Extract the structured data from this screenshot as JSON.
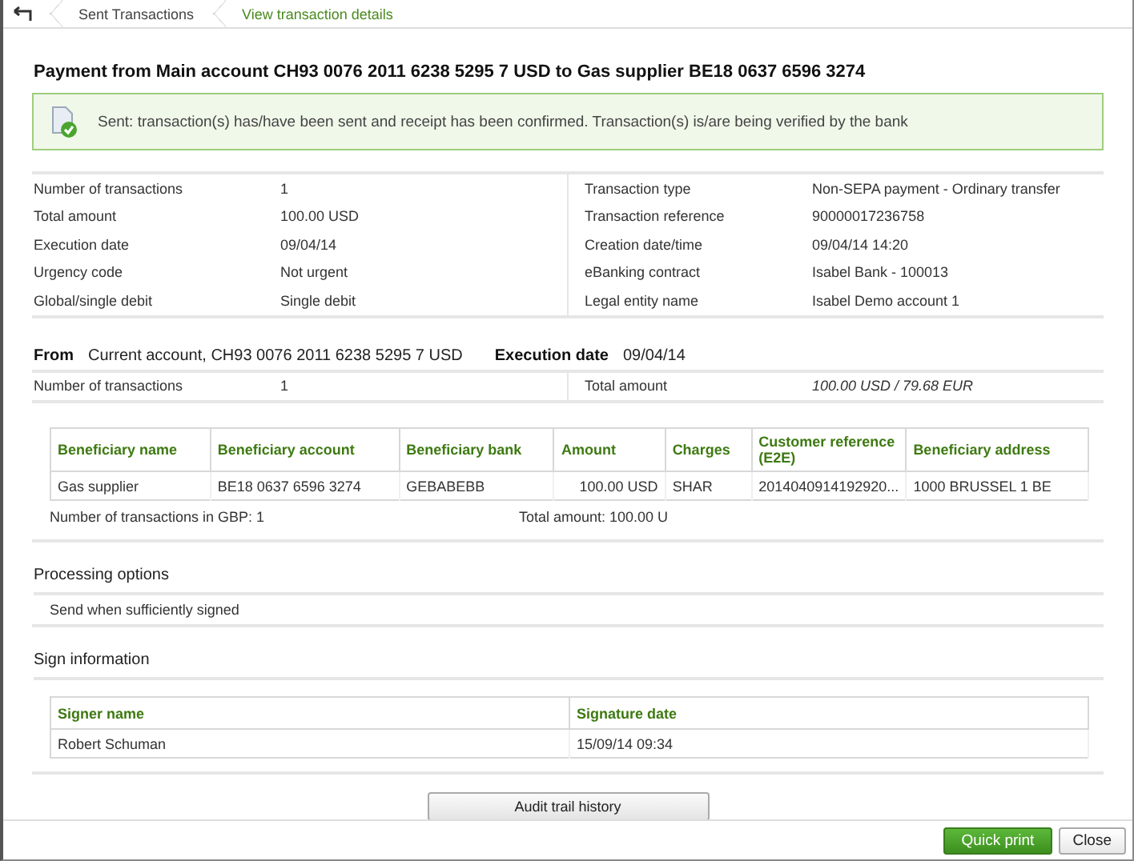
{
  "breadcrumb": [
    {
      "label": "Sent Transactions",
      "selected": false
    },
    {
      "label": "View transaction details",
      "selected": true
    }
  ],
  "title": "Payment from Main account CH93 0076 2011 6238 5295 7 USD to Gas supplier BE18 0637 6596 3274",
  "status_message": "Sent: transaction(s) has/have been sent and receipt has been confirmed. Transaction(s) is/are being verified by the bank",
  "details_left": [
    {
      "label": "Number of transactions",
      "value": "1"
    },
    {
      "label": "Total amount",
      "value": "100.00 USD"
    },
    {
      "label": "Execution date",
      "value": "09/04/14"
    },
    {
      "label": "Urgency code",
      "value": "Not urgent"
    },
    {
      "label": "Global/single debit",
      "value": "Single debit"
    }
  ],
  "details_right": [
    {
      "label": "Transaction type",
      "value": "Non-SEPA payment - Ordinary transfer"
    },
    {
      "label": "Transaction reference",
      "value": "90000017236758"
    },
    {
      "label": "Creation date/time",
      "value": "09/04/14 14:20"
    },
    {
      "label": "eBanking contract",
      "value": "Isabel Bank - 100013"
    },
    {
      "label": "Legal entity name",
      "value": "Isabel Demo account 1"
    }
  ],
  "from": {
    "label": "From",
    "account": "Current account, CH93 0076 2011 6238 5295 7 USD",
    "date_label": "Execution date",
    "date": "09/04/14"
  },
  "from_summary": [
    {
      "label": "Number of transactions",
      "value": "1"
    },
    {
      "label": "Total amount",
      "value": "100.00 USD / 79.68 EUR"
    }
  ],
  "beneficiaries": {
    "columns": [
      "Beneficiary name",
      "Beneficiary account",
      "Beneficiary bank",
      "Amount",
      "Charges",
      "Customer reference (E2E)",
      "Beneficiary address"
    ],
    "rows": [
      [
        "Gas supplier",
        "BE18 0637 6596 3274",
        "GEBABEBB",
        "100.00 USD",
        "SHAR",
        "2014040914192920...",
        "1000 BRUSSEL 1 BE"
      ]
    ],
    "count": "Number of transactions in GBP: 1",
    "total": "Total amount: 100.00 U"
  },
  "processing": {
    "heading": "Processing options",
    "text": "Send when sufficiently signed"
  },
  "sign": {
    "heading": "Sign information",
    "columns": [
      "Signer name",
      "Signature date"
    ],
    "rows": [
      [
        "Robert Schuman",
        "15/09/14 09:34"
      ]
    ]
  },
  "audit_button": "Audit trail history",
  "footer_buttons": [
    {
      "label": "Quick print",
      "kind": "primary"
    },
    {
      "label": "Close",
      "kind": "secondary"
    }
  ]
}
